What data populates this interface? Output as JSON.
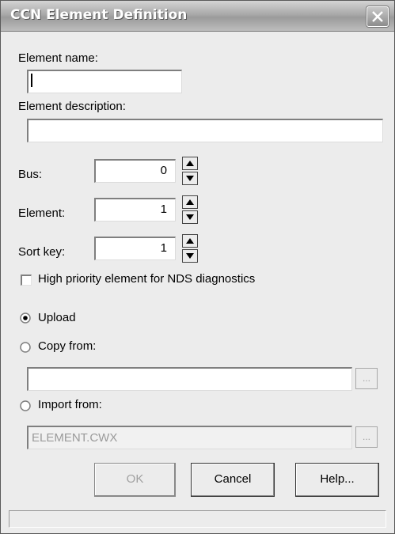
{
  "window": {
    "title": "CCN Element Definition",
    "close": "close"
  },
  "fields": {
    "element_name_label": "Element name:",
    "element_name_value": "",
    "element_description_label": "Element description:",
    "element_description_value": "",
    "bus_label": "Bus:",
    "bus_value": "0",
    "element_label": "Element:",
    "element_value": "1",
    "sort_key_label": "Sort key:",
    "sort_key_value": "1"
  },
  "options": {
    "high_priority_label": "High priority element for NDS diagnostics",
    "high_priority_checked": false,
    "upload_label": "Upload",
    "copy_from_label": "Copy from:",
    "copy_from_value": "",
    "import_from_label": "Import from:",
    "import_from_value": "ELEMENT.CWX",
    "selected": "upload",
    "browse_label": "..."
  },
  "buttons": {
    "ok": "OK",
    "cancel": "Cancel",
    "help": "Help..."
  },
  "icons": [
    "close-icon",
    "arrow-up-icon",
    "arrow-down-icon",
    "radio-icon",
    "checkbox-icon"
  ]
}
